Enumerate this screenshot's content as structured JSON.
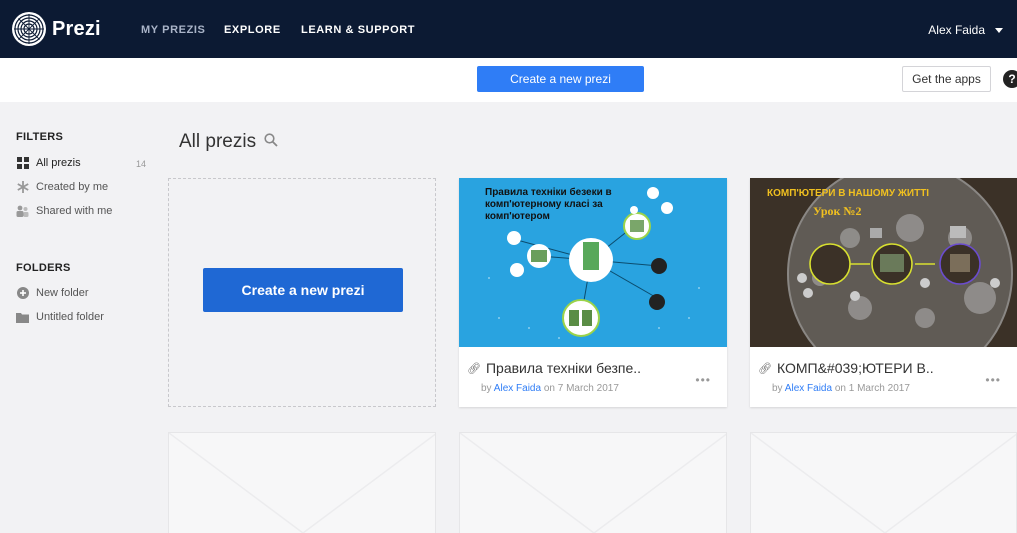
{
  "nav": {
    "logo": "Prezi",
    "items": [
      "MY PREZIS",
      "EXPLORE",
      "LEARN & SUPPORT"
    ],
    "user": "Alex Faida"
  },
  "subbar": {
    "create_label": "Create a new prezi",
    "apps_label": "Get the apps",
    "help_label": "?"
  },
  "sidebar": {
    "filters_heading": "FILTERS",
    "filters": [
      {
        "label": "All prezis",
        "count": "14",
        "icon": "grid-icon"
      },
      {
        "label": "Created by me",
        "icon": "asterisk-icon"
      },
      {
        "label": "Shared with me",
        "icon": "people-icon"
      }
    ],
    "folders_heading": "FOLDERS",
    "folders": [
      {
        "label": "New folder",
        "icon": "plus-circle-icon"
      },
      {
        "label": "Untitled folder",
        "icon": "folder-icon"
      }
    ]
  },
  "main": {
    "title": "All prezis",
    "create_label": "Create a new prezi",
    "cards": [
      {
        "thumb_title": "Правила техніки безеки в комп'ютерному класі за комп'ютером",
        "title": "Правила техніки безпе..",
        "by": "by",
        "author": "Alex Faida",
        "date": "on 7 March 2017",
        "more": "•••"
      },
      {
        "thumb_title": "КОМП'ЮТЕРИ В НАШОМУ ЖИТТІ",
        "thumb_subtitle": "Урок №2",
        "title": "КОМП&#039;ЮТЕРИ В..",
        "by": "by",
        "author": "Alex Faida",
        "date": "on 1 March 2017",
        "more": "•••"
      }
    ]
  },
  "colors": {
    "nav_bg": "#0c1a33",
    "primary": "#2f7df6",
    "primary_dark": "#1f68d4",
    "thumb1_bg": "#29a3e0",
    "thumb2_bg": "#3b3127"
  }
}
